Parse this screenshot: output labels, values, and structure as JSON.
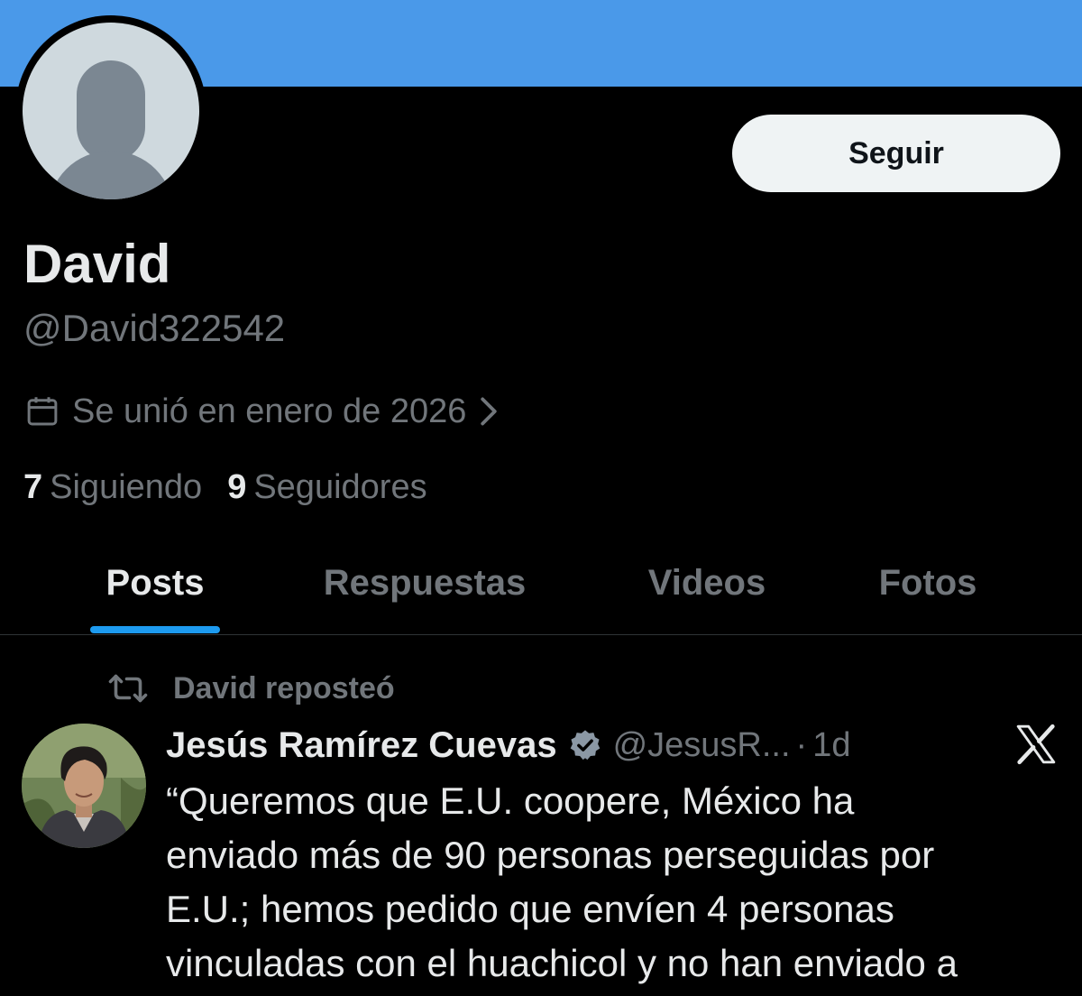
{
  "profile": {
    "display_name": "David",
    "handle": "@David322542",
    "joined": "Se unió en enero de 2026",
    "following_count": "7",
    "following_label": "Siguiendo",
    "followers_count": "9",
    "followers_label": "Seguidores",
    "follow_button_label": "Seguir",
    "banner_color": "#4a99e9"
  },
  "tabs": [
    {
      "label": "Posts",
      "active": true
    },
    {
      "label": "Respuestas",
      "active": false
    },
    {
      "label": "Videos",
      "active": false
    },
    {
      "label": "Fotos",
      "active": false
    }
  ],
  "post": {
    "repost_text": "David reposteó",
    "author_name": "Jesús Ramírez Cuevas",
    "verified": true,
    "author_handle": "@JesusR...",
    "separator": "·",
    "time": "1d",
    "text": "“Queremos que E.U. coopere, México ha\nenviado más de 90 personas perseguidas por\nE.U.; hemos pedido que envíen 4 personas\nvinculadas con el huachicol y no han enviado a",
    "source_icon": "x-logo-icon"
  },
  "colors": {
    "background": "#000000",
    "text_primary": "#e7e9ea",
    "text_secondary": "#71767b",
    "accent": "#1d9bf0"
  }
}
